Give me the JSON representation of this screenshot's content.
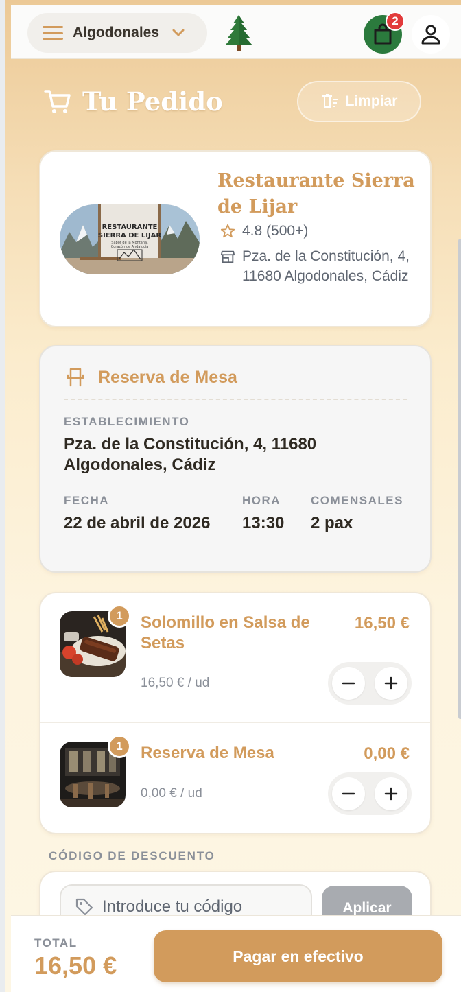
{
  "header": {
    "location": "Algodonales",
    "cart_count": "2"
  },
  "page": {
    "title": "Tu Pedido",
    "clear_label": "Limpiar"
  },
  "restaurant": {
    "name": "Restaurante Sierra de Lijar",
    "rating": "4.8 (500+)",
    "address": "Pza. de la Constitución, 4, 11680 Algodonales, Cádiz",
    "image_text": {
      "line1": "RESTAURANTE",
      "line2": "SIERRA DE LIJAR",
      "tagline1": "Sabor de la Montaña,",
      "tagline2": "Corazón de Andalucía"
    }
  },
  "reservation": {
    "title": "Reserva de Mesa",
    "establishment_label": "ESTABLECIMIENTO",
    "establishment_value": "Pza. de la Constitución, 4, 11680 Algodonales, Cádiz",
    "date_label": "FECHA",
    "date_value": "22 de abril de 2026",
    "time_label": "HORA",
    "time_value": "13:30",
    "guests_label": "COMENSALES",
    "guests_value": "2 pax"
  },
  "items": [
    {
      "name": "Solomillo en Salsa de Setas",
      "price": "16,50 €",
      "unit": "16,50 € / ud",
      "qty": "1",
      "minus": "−",
      "plus": "+"
    },
    {
      "name": "Reserva de Mesa",
      "price": "0,00 €",
      "unit": "0,00 € / ud",
      "qty": "1",
      "minus": "−",
      "plus": "+"
    }
  ],
  "discount": {
    "label": "CÓDIGO DE DESCUENTO",
    "placeholder": "Introduce tu código",
    "apply_label": "Aplicar"
  },
  "footer": {
    "total_label": "TOTAL",
    "total_value": "16,50 €",
    "pay_label": "Pagar en efectivo"
  },
  "colors": {
    "accent": "#d29b5c",
    "cart_green": "#2b7a3d",
    "badge_red": "#e23b3b",
    "muted": "#8b9099"
  },
  "icons": [
    "menu-icon",
    "chevron-down-icon",
    "pine-tree-icon",
    "shopping-bag-icon",
    "user-icon",
    "cart-icon",
    "trash-icon",
    "star-icon",
    "store-icon",
    "chair-icon",
    "minus-icon",
    "plus-icon",
    "tag-icon"
  ]
}
